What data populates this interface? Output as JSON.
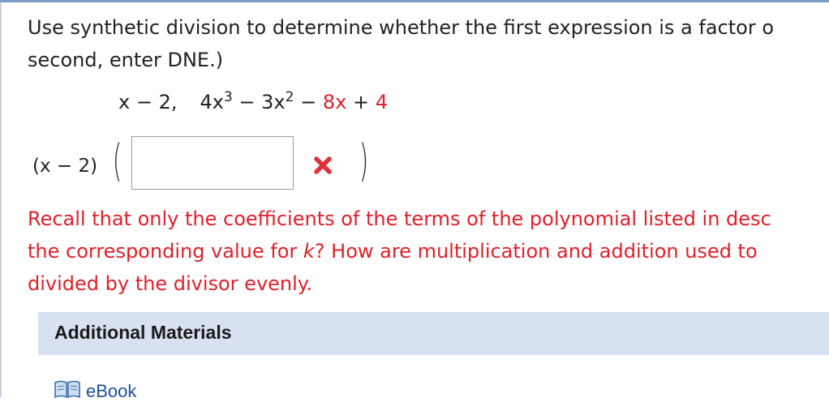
{
  "question": {
    "line1": "Use synthetic division to determine whether the first expression is a factor o",
    "line2": "second, enter DNE.)"
  },
  "expression": {
    "divisor": "x − 2,",
    "poly_t1": "4x",
    "poly_t1_exp": "3",
    "poly_op1": " − 3x",
    "poly_t2_exp": "2",
    "poly_op2": " − ",
    "poly_t3": "8x",
    "poly_op3": " + ",
    "poly_t4": "4"
  },
  "answer": {
    "divisor_label": "(x − 2)",
    "open_paren": "(",
    "close_paren": ")",
    "value": "",
    "status": "incorrect"
  },
  "feedback": {
    "line1": "Recall that only the coefficients of the terms of the polynomial listed in desc",
    "line2_a": "the corresponding value for ",
    "line2_k": "k",
    "line2_b": "? How are multiplication and addition used to ",
    "line3": "divided by the divisor evenly."
  },
  "materials": {
    "title": "Additional Materials",
    "link_label": "eBook"
  },
  "colors": {
    "feedback_red": "#e0202a",
    "materials_bg": "#d8e1f2",
    "link_blue": "#1c4f9c"
  }
}
